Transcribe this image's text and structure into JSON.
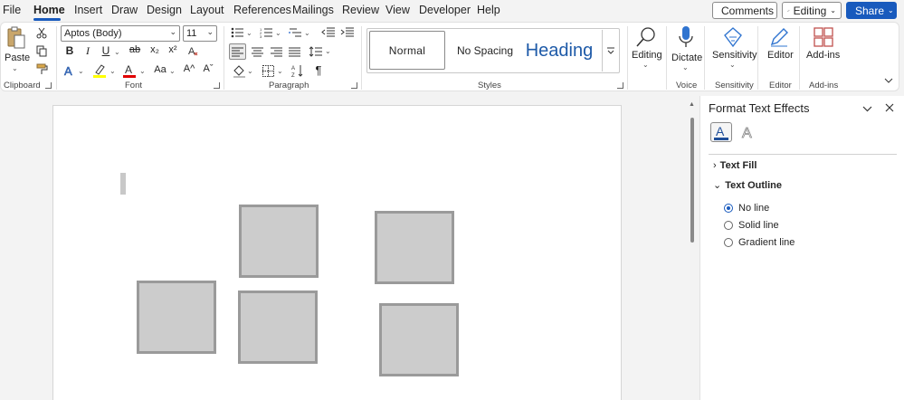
{
  "menu": {
    "tabs": [
      "File",
      "Home",
      "Insert",
      "Draw",
      "Design",
      "Layout",
      "References",
      "Mailings",
      "Review",
      "View",
      "Developer",
      "Help"
    ],
    "active_tab": "Home",
    "comments_label": "Comments",
    "editing_label": "Editing",
    "share_label": "Share"
  },
  "ribbon": {
    "clipboard": {
      "paste_label": "Paste",
      "group_label": "Clipboard"
    },
    "font": {
      "font_name": "Aptos (Body)",
      "font_size": "11",
      "group_label": "Font",
      "bold": "B",
      "italic": "I",
      "underline": "U",
      "strike": "ab",
      "subscript": "x₂",
      "superscript": "x²",
      "grow": "A^",
      "shrink": "Aˇ",
      "case": "Aa"
    },
    "paragraph": {
      "group_label": "Paragraph",
      "pilcrow": "¶"
    },
    "styles": {
      "group_label": "Styles",
      "items": [
        "Normal",
        "No Spacing",
        "Heading"
      ]
    },
    "editing": {
      "label": "Editing"
    },
    "voice": {
      "dictate_label": "Dictate",
      "group_label": "Voice"
    },
    "sensitivity": {
      "label": "Sensitivity",
      "group_label": "Sensitivity"
    },
    "editor": {
      "label": "Editor",
      "group_label": "Editor"
    },
    "addins": {
      "label": "Add-ins",
      "group_label": "Add-ins"
    }
  },
  "pane": {
    "title": "Format Text Effects",
    "sections": {
      "text_fill": "Text Fill",
      "text_outline": "Text Outline"
    },
    "outline_options": [
      "No line",
      "Solid line",
      "Gradient line"
    ],
    "selected_option": "No line"
  },
  "colors": {
    "accent": "#185abd",
    "shape_fill": "#cccccc",
    "shape_border": "#9a9a9a",
    "highlight_yellow": "#ffff00",
    "font_color_red": "#e00000"
  }
}
